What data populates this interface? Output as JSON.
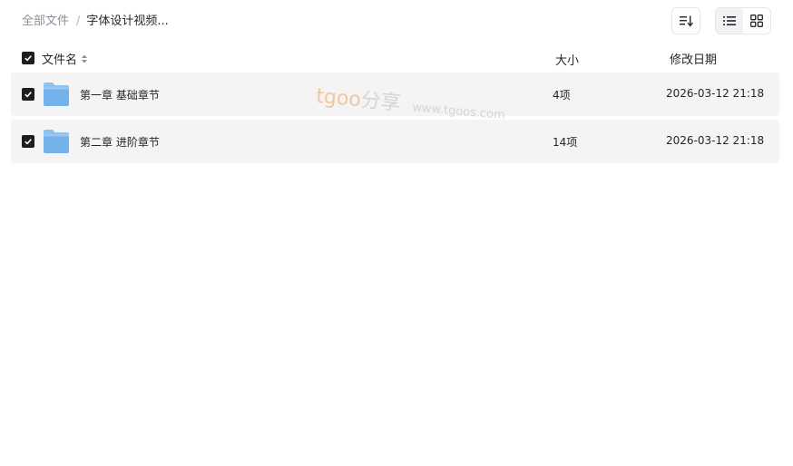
{
  "breadcrumb": {
    "root": "全部文件",
    "separator": "/",
    "current": "字体设计视频..."
  },
  "toolbar": {
    "sort_icon": "sort-icon",
    "list_view_icon": "list-view-icon",
    "grid_view_icon": "grid-view-icon",
    "active_view": "list"
  },
  "table": {
    "columns": {
      "name": "文件名",
      "size": "大小",
      "date": "修改日期"
    },
    "select_all_checked": true,
    "rows": [
      {
        "name": "第一章 基础章节",
        "size": "4项",
        "date": "2026-03-12 21:18",
        "checked": true,
        "icon": "folder-icon"
      },
      {
        "name": "第二章 进阶章节",
        "size": "14项",
        "date": "2026-03-12 21:18",
        "checked": true,
        "icon": "folder-icon"
      }
    ]
  },
  "watermark": {
    "brand_latin": "tgoo",
    "brand_cjk": "分享",
    "url": "www.tgoos.com"
  },
  "colors": {
    "folder": "#7ab8ec",
    "row_background": "#f4f4f5",
    "checkbox": "#1c1d21"
  }
}
